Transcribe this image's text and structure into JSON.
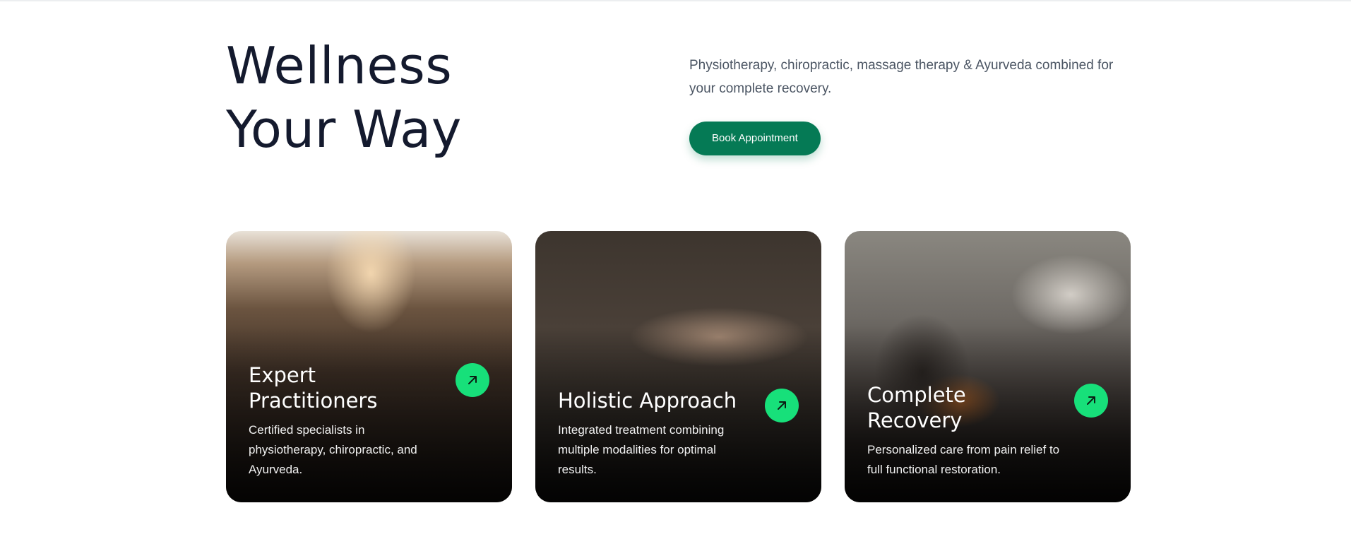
{
  "hero": {
    "title_line1": "Wellness",
    "title_line2": "Your Way",
    "description": "Physiotherapy, chiropractic, massage therapy & Ayurveda combined for your complete recovery.",
    "cta_label": "Book Appointment"
  },
  "cards": [
    {
      "title_line1": "Expert",
      "title_line2": "Practitioners",
      "description": "Certified specialists in physiotherapy, chiropractic, and Ayurveda.",
      "icon": "arrow-up-right-icon"
    },
    {
      "title_line1": "Holistic Approach",
      "description": "Integrated treatment combining multiple modalities for optimal results.",
      "icon": "arrow-up-right-icon"
    },
    {
      "title_line1": "Complete",
      "title_line2": "Recovery",
      "description": "Personalized care from pain relief to full functional restoration.",
      "icon": "arrow-up-right-icon"
    }
  ],
  "colors": {
    "brand_green": "#057a55",
    "accent_green": "#17e07a",
    "heading": "#141a2e",
    "body_text": "#4b5563"
  }
}
